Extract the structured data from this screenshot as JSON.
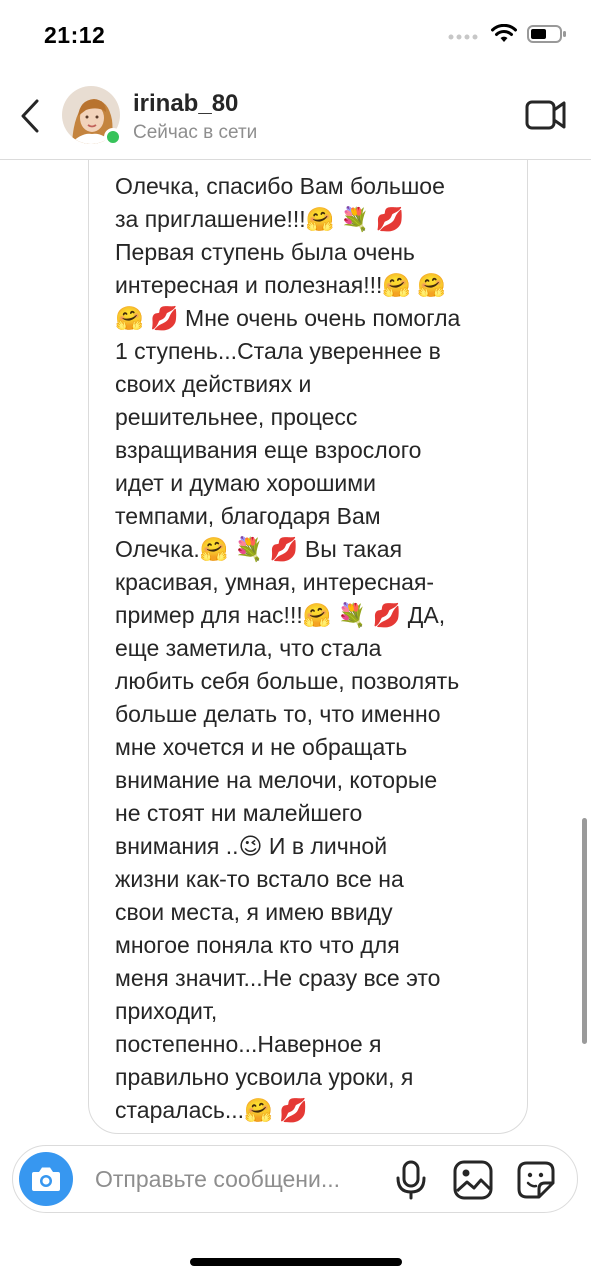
{
  "status_bar": {
    "time": "21:12"
  },
  "header": {
    "username": "irinab_80",
    "status": "Сейчас в сети",
    "online_color": "#37c35a"
  },
  "message": {
    "text": "Олечка, спасибо Вам большое\nза приглашение!!!🤗 💐 💋\nПервая ступень была очень\nинтересная и полезная!!!🤗 🤗\n🤗 💋 Мне очень очень помогла\n1 ступень...Стала увереннее в\nсвоих действиях и\nрешительнее, процесс\nвзращивания еще взрослого\nидет и думаю хорошими\nтемпами, благодаря Вам\nОлечка.🤗 💐 💋  Вы такая\nкрасивая, умная, интересная-\nпример для нас!!!🤗 💐 💋 ДА,\nеще заметила, что стала\nлюбить себя больше, позволять\nбольше делать то, что именно\nмне хочется и не обращать\nвнимание на мелочи, которые\nне стоят ни малейшего\nвнимания ..😉 И в личной\nжизни как-то встало все на\nсвои места, я имею ввиду\nмногое поняла кто что для\nменя значит...Не сразу все это\nприходит,\nпостепенно...Наверное я\nправильно усвоила уроки, я\nстаралась...🤗 💋"
  },
  "composer": {
    "placeholder": "Отправьте сообщени...",
    "camera_color": "#3797f0"
  },
  "icons": {
    "back": "chevron-left-icon",
    "video": "video-camera-icon",
    "camera": "camera-icon",
    "mic": "microphone-icon",
    "gallery": "image-icon",
    "sticker": "sticker-icon"
  }
}
